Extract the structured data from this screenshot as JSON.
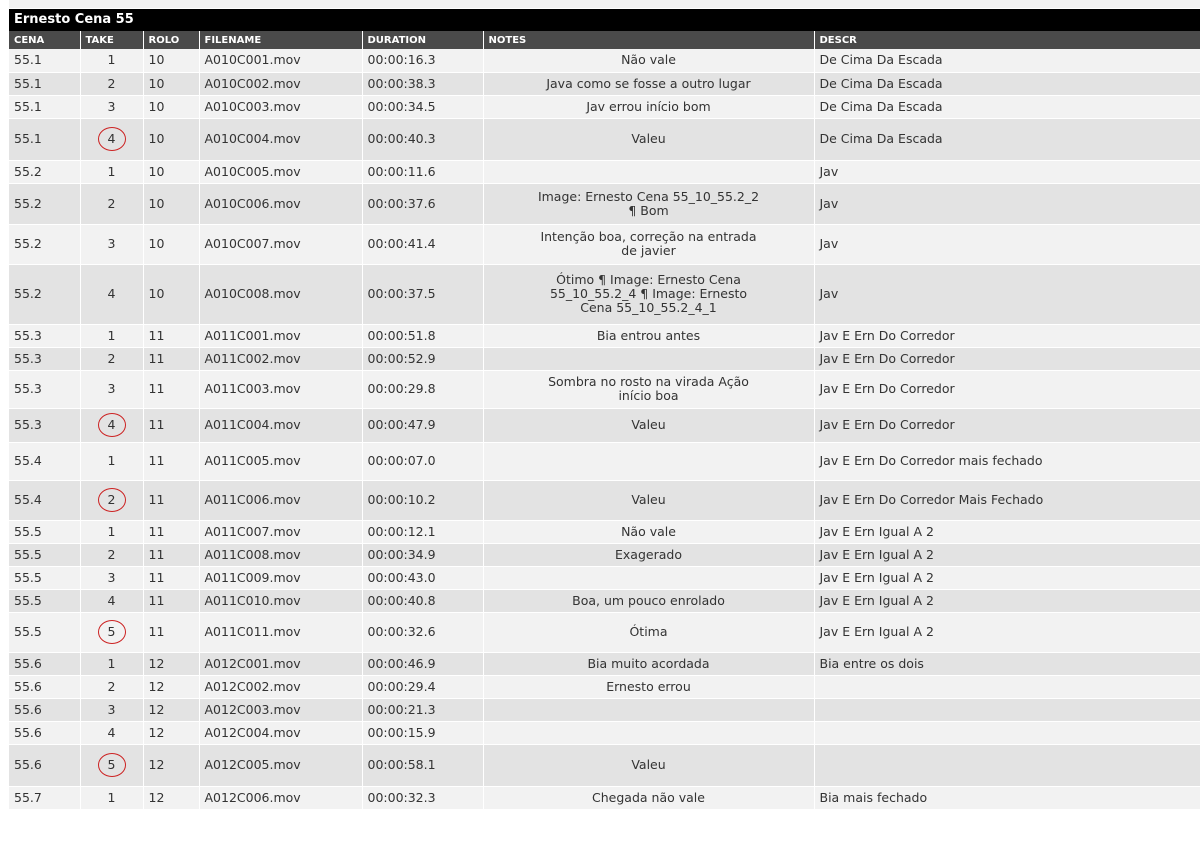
{
  "title": "Ernesto Cena 55",
  "columns": [
    "CENA",
    "TAKE",
    "ROLO",
    "FILENAME",
    "DURATION",
    "NOTES",
    "DESCR"
  ],
  "rows": [
    {
      "cena": "55.1",
      "take": "1",
      "rolo": "10",
      "file": "A010C001.mov",
      "dur": "00:00:16.3",
      "notes": "Não vale",
      "descr": "De Cima Da Escada",
      "circled": false,
      "h": 23
    },
    {
      "cena": "55.1",
      "take": "2",
      "rolo": "10",
      "file": "A010C002.mov",
      "dur": "00:00:38.3",
      "notes": "Java como se fosse a outro lugar",
      "descr": "De Cima Da Escada",
      "circled": false,
      "h": 23
    },
    {
      "cena": "55.1",
      "take": "3",
      "rolo": "10",
      "file": "A010C003.mov",
      "dur": "00:00:34.5",
      "notes": "Jav errou início bom",
      "descr": "De Cima Da Escada",
      "circled": false,
      "h": 23
    },
    {
      "cena": "55.1",
      "take": "4",
      "rolo": "10",
      "file": "A010C004.mov",
      "dur": "00:00:40.3",
      "notes": "Valeu",
      "descr": "De Cima Da Escada",
      "circled": true,
      "h": 42
    },
    {
      "cena": "55.2",
      "take": "1",
      "rolo": "10",
      "file": "A010C005.mov",
      "dur": "00:00:11.6",
      "notes": "",
      "descr": "Jav",
      "circled": false,
      "h": 23
    },
    {
      "cena": "55.2",
      "take": "2",
      "rolo": "10",
      "file": "A010C006.mov",
      "dur": "00:00:37.6",
      "notes": "Image: Ernesto Cena 55_10_55.2_2 ¶ Bom",
      "descr": "Jav",
      "circled": false,
      "h": 41
    },
    {
      "cena": "55.2",
      "take": "3",
      "rolo": "10",
      "file": "A010C007.mov",
      "dur": "00:00:41.4",
      "notes": "Intenção boa, correção na entrada de javier",
      "descr": "Jav",
      "circled": false,
      "h": 40
    },
    {
      "cena": "55.2",
      "take": "4",
      "rolo": "10",
      "file": "A010C008.mov",
      "dur": "00:00:37.5",
      "notes": "Ótimo ¶ Image: Ernesto Cena 55_10_55.2_4 ¶ Image: Ernesto Cena 55_10_55.2_4_1",
      "descr": "Jav",
      "circled": false,
      "h": 60
    },
    {
      "cena": "55.3",
      "take": "1",
      "rolo": "11",
      "file": "A011C001.mov",
      "dur": "00:00:51.8",
      "notes": "Bia entrou antes",
      "descr": "Jav E Ern Do Corredor",
      "circled": false,
      "h": 23
    },
    {
      "cena": "55.3",
      "take": "2",
      "rolo": "11",
      "file": "A011C002.mov",
      "dur": "00:00:52.9",
      "notes": "",
      "descr": "Jav E Ern Do Corredor",
      "circled": false,
      "h": 23
    },
    {
      "cena": "55.3",
      "take": "3",
      "rolo": "11",
      "file": "A011C003.mov",
      "dur": "00:00:29.8",
      "notes": "Sombra no rosto na virada Ação início boa",
      "descr": "Jav E Ern Do Corredor",
      "circled": false,
      "h": 38
    },
    {
      "cena": "55.3",
      "take": "4",
      "rolo": "11",
      "file": "A011C004.mov",
      "dur": "00:00:47.9",
      "notes": "Valeu",
      "descr": "Jav E Ern Do Corredor",
      "circled": true,
      "h": 34
    },
    {
      "cena": "55.4",
      "take": "1",
      "rolo": "11",
      "file": "A011C005.mov",
      "dur": "00:00:07.0",
      "notes": "",
      "descr": "Jav E Ern Do Corredor mais fechado",
      "circled": false,
      "h": 38
    },
    {
      "cena": "55.4",
      "take": "2",
      "rolo": "11",
      "file": "A011C006.mov",
      "dur": "00:00:10.2",
      "notes": "Valeu",
      "descr": "Jav E Ern Do Corredor Mais Fechado",
      "circled": true,
      "h": 40
    },
    {
      "cena": "55.5",
      "take": "1",
      "rolo": "11",
      "file": "A011C007.mov",
      "dur": "00:00:12.1",
      "notes": "Não vale",
      "descr": "Jav E Ern Igual A 2",
      "circled": false,
      "h": 23
    },
    {
      "cena": "55.5",
      "take": "2",
      "rolo": "11",
      "file": "A011C008.mov",
      "dur": "00:00:34.9",
      "notes": "Exagerado",
      "descr": "Jav E Ern Igual A 2",
      "circled": false,
      "h": 23
    },
    {
      "cena": "55.5",
      "take": "3",
      "rolo": "11",
      "file": "A011C009.mov",
      "dur": "00:00:43.0",
      "notes": "",
      "descr": "Jav E Ern Igual A 2",
      "circled": false,
      "h": 23
    },
    {
      "cena": "55.5",
      "take": "4",
      "rolo": "11",
      "file": "A011C010.mov",
      "dur": "00:00:40.8",
      "notes": "Boa, um pouco enrolado",
      "descr": "Jav E Ern Igual A 2",
      "circled": false,
      "h": 23
    },
    {
      "cena": "55.5",
      "take": "5",
      "rolo": "11",
      "file": "A011C011.mov",
      "dur": "00:00:32.6",
      "notes": "Ótima",
      "descr": "Jav E Ern Igual A 2",
      "circled": true,
      "h": 40
    },
    {
      "cena": "55.6",
      "take": "1",
      "rolo": "12",
      "file": "A012C001.mov",
      "dur": "00:00:46.9",
      "notes": "Bia muito acordada",
      "descr": "Bia entre os dois",
      "circled": false,
      "h": 23
    },
    {
      "cena": "55.6",
      "take": "2",
      "rolo": "12",
      "file": "A012C002.mov",
      "dur": "00:00:29.4",
      "notes": "Ernesto errou",
      "descr": "",
      "circled": false,
      "h": 23
    },
    {
      "cena": "55.6",
      "take": "3",
      "rolo": "12",
      "file": "A012C003.mov",
      "dur": "00:00:21.3",
      "notes": "",
      "descr": "",
      "circled": false,
      "h": 23
    },
    {
      "cena": "55.6",
      "take": "4",
      "rolo": "12",
      "file": "A012C004.mov",
      "dur": "00:00:15.9",
      "notes": "",
      "descr": "",
      "circled": false,
      "h": 23
    },
    {
      "cena": "55.6",
      "take": "5",
      "rolo": "12",
      "file": "A012C005.mov",
      "dur": "00:00:58.1",
      "notes": "Valeu",
      "descr": "",
      "circled": true,
      "h": 42
    },
    {
      "cena": "55.7",
      "take": "1",
      "rolo": "12",
      "file": "A012C006.mov",
      "dur": "00:00:32.3",
      "notes": "Chegada não vale",
      "descr": "Bia mais fechado",
      "circled": false,
      "h": 23
    }
  ]
}
